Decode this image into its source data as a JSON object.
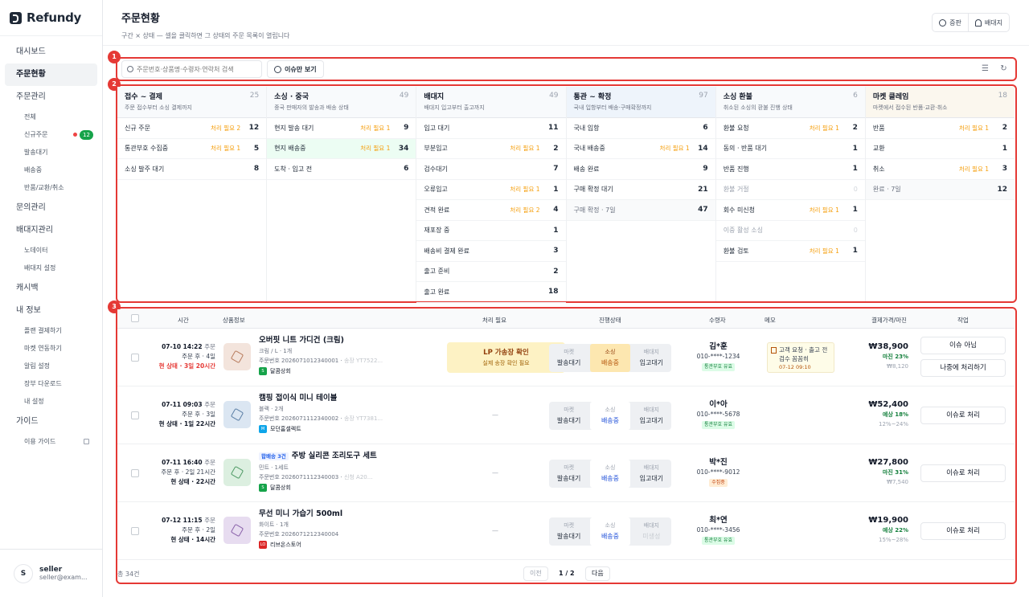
{
  "brand": {
    "name": "Refundy"
  },
  "sidebar": {
    "items": [
      {
        "label": "대시보드",
        "type": "top",
        "active": false
      },
      {
        "label": "주문현황",
        "type": "top",
        "active": true
      },
      {
        "label": "주문관리",
        "type": "top",
        "active": false
      },
      {
        "label": "전체",
        "type": "sub"
      },
      {
        "label": "신규주문",
        "type": "sub",
        "badge": "12"
      },
      {
        "label": "발송대기",
        "type": "sub"
      },
      {
        "label": "배송중",
        "type": "sub"
      },
      {
        "label": "반품/교환/취소",
        "type": "sub"
      },
      {
        "label": "문의관리",
        "type": "top",
        "active": false
      },
      {
        "label": "배대지관리",
        "type": "top",
        "active": false
      },
      {
        "label": "노데이터",
        "type": "sub"
      },
      {
        "label": "배대지 설정",
        "type": "sub"
      },
      {
        "label": "캐시백",
        "type": "top",
        "active": false
      },
      {
        "label": "내 정보",
        "type": "top",
        "active": false
      },
      {
        "label": "플랜 결제하기",
        "type": "sub"
      },
      {
        "label": "마켓 연동하기",
        "type": "sub"
      },
      {
        "label": "알림 설정",
        "type": "sub"
      },
      {
        "label": "장부 다운로드",
        "type": "sub"
      },
      {
        "label": "내 설정",
        "type": "sub"
      },
      {
        "label": "가이드",
        "type": "top",
        "active": false
      },
      {
        "label": "이용 가이드",
        "type": "sub",
        "external": true
      }
    ],
    "user": {
      "initial": "S",
      "name": "seller",
      "email": "seller@exam..."
    }
  },
  "header": {
    "title": "주문현황",
    "subtitle": "구간 × 상태 — 셀을 클릭하면 그 상태의 주문 목록이 열립니다",
    "btn_feedback": "증판",
    "btn_notice": "배대지"
  },
  "callouts": [
    "1",
    "2",
    "3"
  ],
  "toolbar": {
    "search_placeholder": "주문번호·상품명·수령자·연락처 검색",
    "issue_only": "이슈만 보기"
  },
  "kanban": [
    {
      "title": "접수 ~ 결제",
      "desc": "주문 접수부터 소싱 결제까지",
      "count": "25",
      "tone": "plain",
      "rows": [
        {
          "label": "신규 주문",
          "need": "처리 필요 2",
          "count": "12"
        },
        {
          "label": "통관부호 수집중",
          "need": "처리 필요 1",
          "count": "5"
        },
        {
          "label": "소싱 발주 대기",
          "need": "",
          "count": "8"
        }
      ]
    },
    {
      "title": "소싱 · 중국",
      "desc": "중국 판매자의 발송과 배송 상태",
      "count": "49",
      "tone": "plain",
      "rows": [
        {
          "label": "현지 발송 대기",
          "need": "처리 필요 1",
          "count": "9"
        },
        {
          "label": "현지 배송중",
          "need": "처리 필요 1",
          "count": "34",
          "hl": true
        },
        {
          "label": "도착 · 입고 전",
          "need": "",
          "count": "6"
        }
      ]
    },
    {
      "title": "배대지",
      "desc": "배대지 입고부터 출고까지",
      "count": "49",
      "tone": "plain",
      "rows": [
        {
          "label": "입고 대기",
          "need": "",
          "count": "11"
        },
        {
          "label": "부분입고",
          "need": "처리 필요 1",
          "count": "2"
        },
        {
          "label": "검수대기",
          "need": "",
          "count": "7"
        },
        {
          "label": "오류입고",
          "need": "처리 필요 1",
          "count": "1"
        },
        {
          "label": "견적 완료",
          "need": "처리 필요 2",
          "count": "4"
        },
        {
          "label": "재포장 중",
          "need": "",
          "count": "1"
        },
        {
          "label": "배송비 결제 완료",
          "need": "",
          "count": "3"
        },
        {
          "label": "출고 준비",
          "need": "",
          "count": "2"
        },
        {
          "label": "출고 완료",
          "need": "",
          "count": "18"
        }
      ]
    },
    {
      "title": "통관 ~ 확정",
      "desc": "국내 입항부터 배송·구매확정까지",
      "count": "97",
      "tone": "blue",
      "rows": [
        {
          "label": "국내 입항",
          "need": "",
          "count": "6"
        },
        {
          "label": "국내 배송중",
          "need": "처리 필요 1",
          "count": "14"
        },
        {
          "label": "배송 완료",
          "need": "",
          "count": "9"
        },
        {
          "label": "구매 확정 대기",
          "need": "",
          "count": "21"
        },
        {
          "label": "구매 확정 · 7일",
          "need": "",
          "count": "47",
          "grey": true
        }
      ]
    },
    {
      "title": "소싱 환불",
      "desc": "취소된 소싱의 환불 진행 상태",
      "count": "6",
      "tone": "plain",
      "rows": [
        {
          "label": "환불 요청",
          "need": "처리 필요 1",
          "count": "2"
        },
        {
          "label": "동의 · 반품 대기",
          "need": "",
          "count": "1"
        },
        {
          "label": "반품 진행",
          "need": "",
          "count": "1"
        },
        {
          "label": "환불 거절",
          "need": "",
          "count": "0",
          "muted": true
        },
        {
          "label": "회수 미신청",
          "need": "처리 필요 1",
          "count": "1"
        },
        {
          "label": "이중 활성 소싱",
          "need": "",
          "count": "0",
          "muted": true
        },
        {
          "label": "환불 검토",
          "need": "처리 필요 1",
          "count": "1"
        }
      ]
    },
    {
      "title": "마켓 클레임",
      "desc": "마켓에서 접수된 반품·교환·취소",
      "count": "18",
      "tone": "yellow",
      "rows": [
        {
          "label": "반품",
          "need": "처리 필요 1",
          "count": "2"
        },
        {
          "label": "교환",
          "need": "",
          "count": "1"
        },
        {
          "label": "취소",
          "need": "처리 필요 1",
          "count": "3"
        },
        {
          "label": "완료 · 7일",
          "need": "",
          "count": "12",
          "grey": true
        }
      ]
    }
  ],
  "table": {
    "headers": {
      "time": "시간",
      "product": "상품정보",
      "need": "처리 필요",
      "progress": "진행상태",
      "receiver": "수령자",
      "memo": "메모",
      "price": "결제가격/마진",
      "action": "작업"
    },
    "rows": [
      {
        "date": "07-10 14:22",
        "date_k": "주문",
        "from": "주문 후 · 4일",
        "state": "현 상태 · 3일 20시간",
        "state_red": true,
        "thumb": {
          "bg": "#f3e4dc",
          "fg": "#b87c5e"
        },
        "tag": "",
        "name": "오버핏 니트 가디건 (크림)",
        "opt": "크림 / L · 1개",
        "order_no": "주문번호 2026071012340001",
        "ship": "송장 YT7522...",
        "store": "달콤상회",
        "store_color": "#16a34a",
        "store_mark": "S",
        "need_title": "LP 가송장 확인",
        "need_desc": "실제 송장 확인 필요",
        "stages": [
          {
            "k": "마켓",
            "v": "발송대기",
            "s": ""
          },
          {
            "k": "소싱",
            "v": "배송중",
            "s": "on"
          },
          {
            "k": "배대지",
            "v": "입고대기",
            "s": ""
          }
        ],
        "recv_name": "김*훈",
        "recv_phone": "010-****-1234",
        "recv_tag": "통관부호 유효",
        "recv_tag_or": false,
        "memo": "고객 요청 · 출고 전 검수 꼼꼼히",
        "memo_time": "07-12 09:10",
        "price": "₩38,900",
        "margin": "마진 23%",
        "sub": "₩8,120",
        "actions": [
          "이슈 아님",
          "나중에 처리하기"
        ]
      },
      {
        "date": "07-11 09:03",
        "date_k": "주문",
        "from": "주문 후 · 3일",
        "state": "현 상태 · 1일 22시간",
        "state_red": false,
        "thumb": {
          "bg": "#dbe6f2",
          "fg": "#5b7fa6"
        },
        "tag": "",
        "name": "캠핑 접이식 미니 테이블",
        "opt": "블랙 · 2개",
        "order_no": "주문번호 2026071112340002",
        "ship": "송장 YT7381...",
        "store": "모던홈셀렉트",
        "store_color": "#0ea5e9",
        "store_mark": "M",
        "need_title": "",
        "need_desc": "",
        "stages": [
          {
            "k": "마켓",
            "v": "발송대기",
            "s": ""
          },
          {
            "k": "소싱",
            "v": "배송중",
            "s": "cur"
          },
          {
            "k": "배대지",
            "v": "입고대기",
            "s": ""
          }
        ],
        "recv_name": "이*아",
        "recv_phone": "010-****-5678",
        "recv_tag": "통관부호 유효",
        "recv_tag_or": false,
        "memo": "",
        "memo_time": "",
        "price": "₩52,400",
        "margin": "예상 18%",
        "sub": "12%~24%",
        "actions": [
          "이슈로 처리"
        ]
      },
      {
        "date": "07-11 16:40",
        "date_k": "주문",
        "from": "주문 후 · 2일 21시간",
        "state": "현 상태 · 22시간",
        "state_red": false,
        "thumb": {
          "bg": "#dcefe0",
          "fg": "#4f9a65"
        },
        "tag": "합배송 3건",
        "name": "주방 실리콘 조리도구 세트",
        "opt": "민트 · 1세트",
        "order_no": "주문번호 2026071112340003",
        "ship": "신청 A20...",
        "store": "달콤상회",
        "store_color": "#16a34a",
        "store_mark": "S",
        "need_title": "",
        "need_desc": "",
        "stages": [
          {
            "k": "마켓",
            "v": "발송대기",
            "s": ""
          },
          {
            "k": "소싱",
            "v": "배송중",
            "s": "cur"
          },
          {
            "k": "배대지",
            "v": "입고대기",
            "s": ""
          }
        ],
        "recv_name": "박*진",
        "recv_phone": "010-****-9012",
        "recv_tag": "수집중",
        "recv_tag_or": true,
        "memo": "",
        "memo_time": "",
        "price": "₩27,800",
        "margin": "마진 31%",
        "sub": "₩7,540",
        "actions": [
          "이슈로 처리"
        ]
      },
      {
        "date": "07-12 11:15",
        "date_k": "주문",
        "from": "주문 후 · 2일",
        "state": "현 상태 · 14시간",
        "state_red": false,
        "thumb": {
          "bg": "#e7dcf0",
          "fg": "#8a62aa"
        },
        "tag": "",
        "name": "무선 미니 가습기 500ml",
        "opt": "화이트 · 1개",
        "order_no": "주문번호 2026071212340004",
        "ship": "",
        "store": "리브온스토어",
        "store_color": "#dc2626",
        "store_mark": "LO",
        "need_title": "",
        "need_desc": "",
        "stages": [
          {
            "k": "마켓",
            "v": "발송대기",
            "s": ""
          },
          {
            "k": "소싱",
            "v": "배송중",
            "s": "cur"
          },
          {
            "k": "배대지",
            "v": "미생성",
            "s": "dim"
          }
        ],
        "recv_name": "최*연",
        "recv_phone": "010-****-3456",
        "recv_tag": "통관부호 유효",
        "recv_tag_or": false,
        "memo": "",
        "memo_time": "",
        "price": "₩19,900",
        "margin": "예상 22%",
        "sub": "15%~28%",
        "actions": [
          "이슈로 처리"
        ]
      }
    ],
    "total": "총 34건",
    "prev": "이전",
    "page": "1 / 2",
    "next": "다음",
    "dash": "—"
  }
}
